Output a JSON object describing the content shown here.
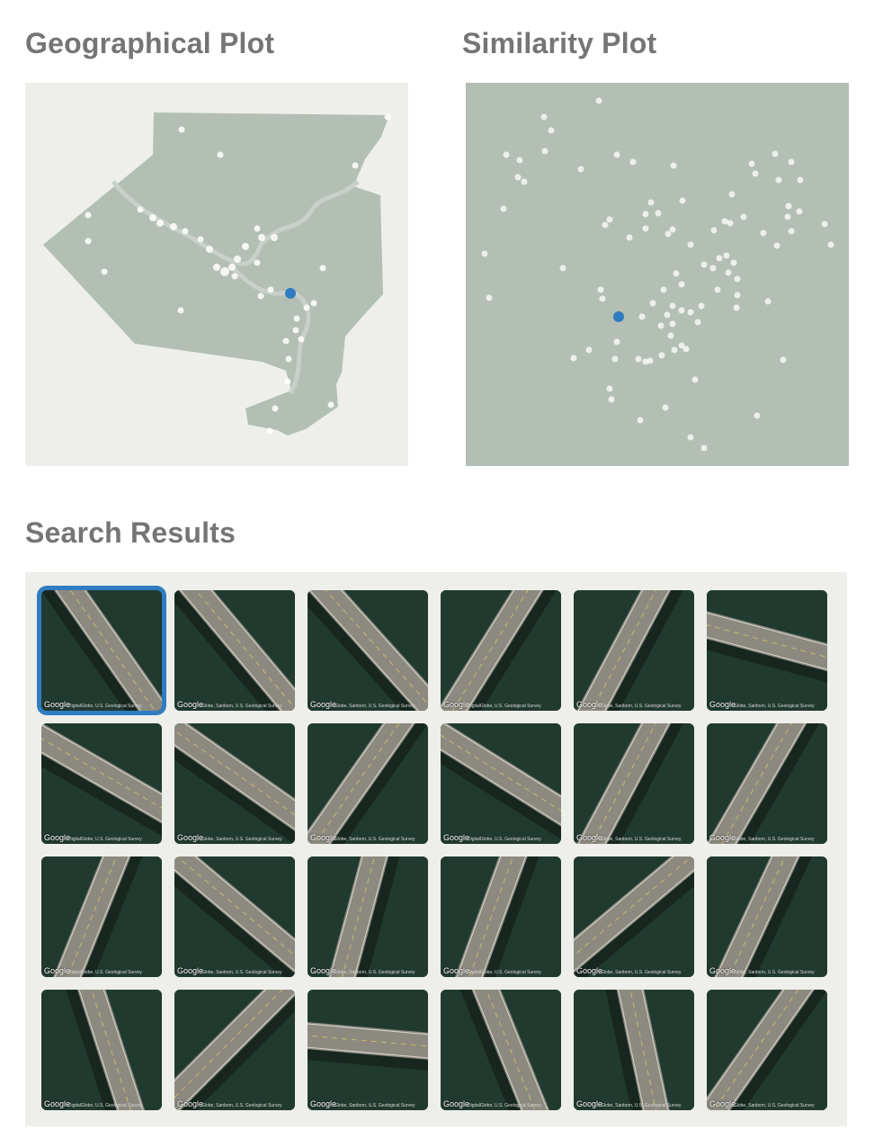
{
  "sections": {
    "geo_title": "Geographical Plot",
    "sim_title": "Similarity Plot",
    "results_title": "Search Results"
  },
  "colors": {
    "map_fill": "#b3bfb4",
    "background": "#eeefeb",
    "point": "#ffffff",
    "selected_point": "#2f7dc0",
    "water": "#213a30",
    "road": "#8c8a80"
  },
  "results": {
    "attribution_logo": "Google",
    "credit_a": "Globe, Sanborn, U.S. Geological Survey",
    "credit_b": "DigitalGlobe, U.S. Geological Survey",
    "selected_index": 0,
    "tiles": [
      {
        "angle": 55
      },
      {
        "angle": 50
      },
      {
        "angle": 48
      },
      {
        "angle": -58
      },
      {
        "angle": -62
      },
      {
        "angle": 15
      },
      {
        "angle": 30
      },
      {
        "angle": 35
      },
      {
        "angle": -55
      },
      {
        "angle": 32
      },
      {
        "angle": -62
      },
      {
        "angle": -60
      },
      {
        "angle": -68
      },
      {
        "angle": 40
      },
      {
        "angle": -75
      },
      {
        "angle": -70
      },
      {
        "angle": -40
      },
      {
        "angle": -65
      },
      {
        "angle": 72
      },
      {
        "angle": -45
      },
      {
        "angle": 5
      },
      {
        "angle": 68
      },
      {
        "angle": 78
      },
      {
        "angle": -55
      }
    ]
  }
}
